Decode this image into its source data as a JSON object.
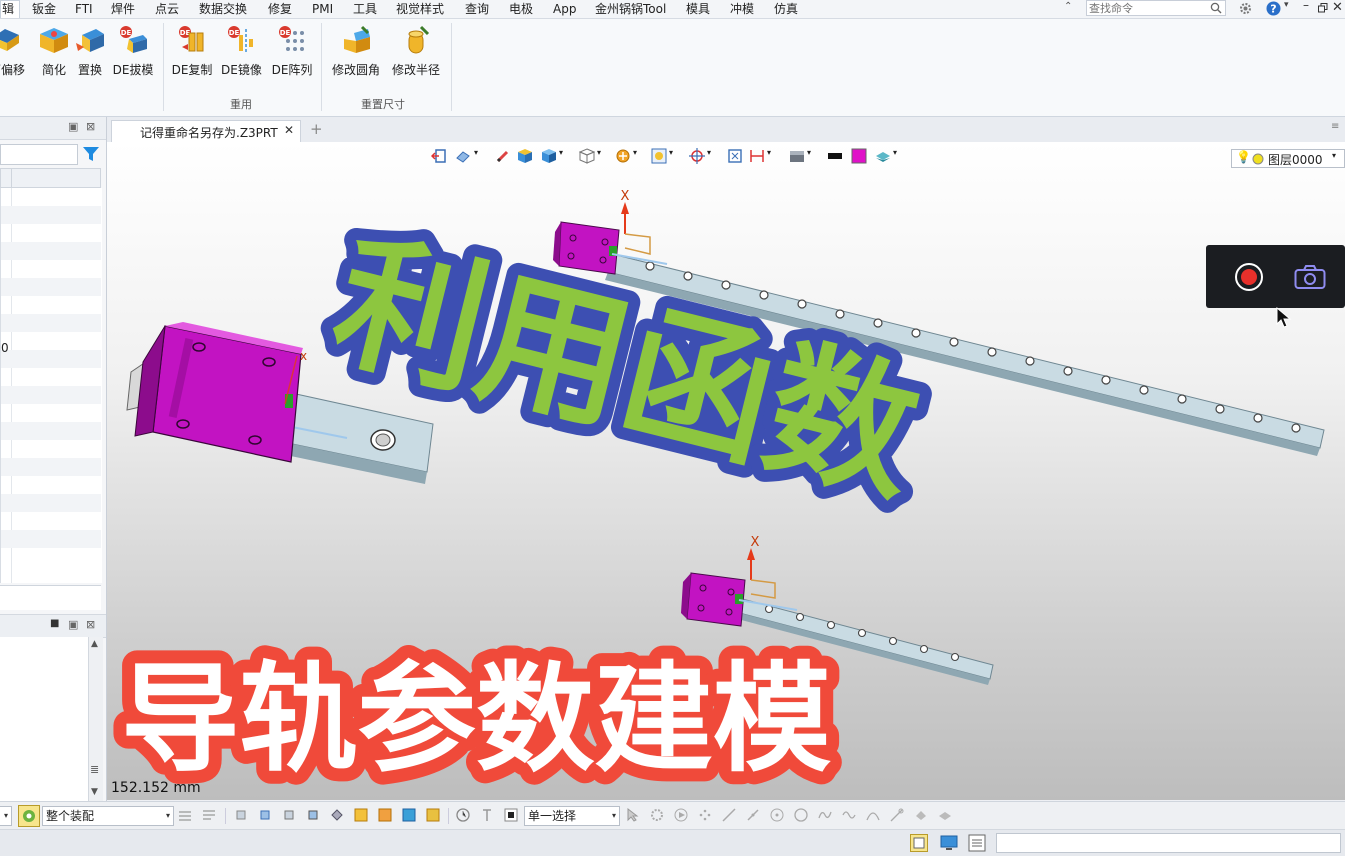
{
  "menubar": {
    "items": [
      "辑",
      "钣金",
      "FTI",
      "焊件",
      "点云",
      "数据交换",
      "修复",
      "PMI",
      "工具",
      "视觉样式",
      "查询",
      "电极",
      "App",
      "金州锅锅Tool",
      "模具",
      "冲模",
      "仿真"
    ],
    "search_placeholder": "查找命令"
  },
  "ribbon": {
    "buttons": [
      {
        "label": "面偏移",
        "icon": "face-offset-icon"
      },
      {
        "label": "简化",
        "icon": "simplify-icon"
      },
      {
        "label": "置换",
        "icon": "replace-icon"
      },
      {
        "label": "DE拔模",
        "icon": "de-draft-icon"
      },
      {
        "label": "DE复制",
        "icon": "de-copy-icon"
      },
      {
        "label": "DE镜像",
        "icon": "de-mirror-icon"
      },
      {
        "label": "DE阵列",
        "icon": "de-pattern-icon"
      },
      {
        "label": "修改圆角",
        "icon": "modify-fillet-icon"
      },
      {
        "label": "修改半径",
        "icon": "modify-radius-icon"
      }
    ],
    "groups": [
      "重用",
      "重置尺寸"
    ]
  },
  "left_panel": {
    "visible_value": "0"
  },
  "document": {
    "tab_title": "记得重命名另存为.Z3PRT"
  },
  "viewport_toolbar": {
    "layer": "图层0000"
  },
  "overlay": {
    "title_top": "利用函数",
    "title_bottom": "导轨参数建模",
    "axis_label": "X"
  },
  "viewport": {
    "measure": "152.152 mm"
  },
  "bottom_toolbar": {
    "assembly_filter": "整个装配",
    "select_mode": "单一选择"
  },
  "colors": {
    "accent": "#2a7bd6",
    "block_magenta": "#cc22cc",
    "rail_blue": "#c4d6de",
    "title_green": "#8dc63f",
    "title_outline_blue": "#3d4fb2",
    "title_red": "#f04a3a",
    "record_red": "#e8302b"
  }
}
